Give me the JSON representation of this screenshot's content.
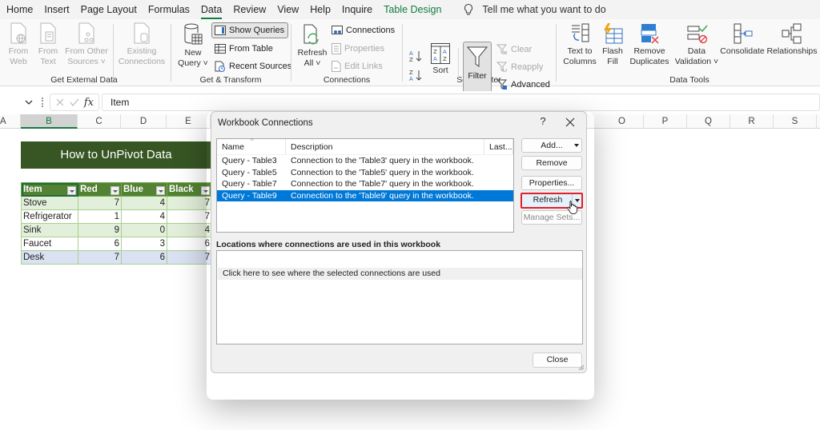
{
  "ribbon_tabs": [
    {
      "label": "Home",
      "active": false
    },
    {
      "label": "Insert",
      "active": false
    },
    {
      "label": "Page Layout",
      "active": false
    },
    {
      "label": "Formulas",
      "active": false
    },
    {
      "label": "Data",
      "active": true
    },
    {
      "label": "Review",
      "active": false
    },
    {
      "label": "View",
      "active": false
    },
    {
      "label": "Help",
      "active": false
    },
    {
      "label": "Inquire",
      "active": false
    },
    {
      "label": "Table Design",
      "active": false,
      "contextual": true
    }
  ],
  "tell_me": "Tell me what you want to do",
  "ribbon": {
    "get_external_data": {
      "label": "Get External Data",
      "from_web": [
        "From",
        "Web"
      ],
      "from_text": [
        "From",
        "Text"
      ],
      "from_other": [
        "From Other",
        "Sources ˅"
      ],
      "existing": [
        "Existing",
        "Connections"
      ]
    },
    "get_transform": {
      "label": "Get & Transform",
      "new_query": [
        "New",
        "Query ˅"
      ],
      "show_queries": "Show Queries",
      "from_table": "From Table",
      "recent_sources": "Recent Sources"
    },
    "connections": {
      "label": "Connections",
      "refresh_all": [
        "Refresh",
        "All ˅"
      ],
      "connections": "Connections",
      "properties": "Properties",
      "edit_links": "Edit Links"
    },
    "sort_filter": {
      "label": "Sort & Filter",
      "sort": "Sort",
      "filter": "Filter",
      "clear": "Clear",
      "reapply": "Reapply",
      "advanced": "Advanced"
    },
    "data_tools": {
      "label": "Data Tools",
      "text_to_columns": [
        "Text to",
        "Columns"
      ],
      "flash_fill": [
        "Flash",
        "Fill"
      ],
      "remove_duplicates": [
        "Remove",
        "Duplicates"
      ],
      "data_validation": [
        "Data",
        "Validation ˅"
      ],
      "consolidate": "Consolidate",
      "relationships": "Relationships"
    }
  },
  "formula_bar": {
    "fx": "fx",
    "value": "Item"
  },
  "columns": [
    "A",
    "B",
    "C",
    "D",
    "E",
    "O",
    "P",
    "Q",
    "R",
    "S"
  ],
  "sheet": {
    "banner": "How to UnPivot Data",
    "table": {
      "headers": [
        "Item",
        "Red",
        "Blue",
        "Black"
      ],
      "rows": [
        [
          "Stove",
          "7",
          "4",
          "7"
        ],
        [
          "Refrigerator",
          "1",
          "4",
          "7"
        ],
        [
          "Sink",
          "9",
          "0",
          "4"
        ],
        [
          "Faucet",
          "6",
          "3",
          "6"
        ],
        [
          "Desk",
          "7",
          "6",
          "7"
        ]
      ]
    }
  },
  "dialog": {
    "title": "Workbook Connections",
    "help": "?",
    "list_headers": [
      "Name",
      "Description",
      "Last..."
    ],
    "connections": [
      {
        "name": "Query - Table3",
        "description": "Connection to the 'Table3' query in the workbook.",
        "selected": false
      },
      {
        "name": "Query - Table5",
        "description": "Connection to the 'Table5' query in the workbook.",
        "selected": false
      },
      {
        "name": "Query - Table7",
        "description": "Connection to the 'Table7' query in the workbook.",
        "selected": false
      },
      {
        "name": "Query - Table9",
        "description": "Connection to the 'Table9' query in the workbook.",
        "selected": true
      }
    ],
    "buttons": {
      "add": "Add...",
      "remove": "Remove",
      "properties": "Properties...",
      "refresh": "Refresh",
      "manage_sets": "Manage Sets...",
      "close": "Close"
    },
    "locations_label": "Locations where connections are used in this workbook",
    "locations_hint": "Click here to see where the selected connections are used"
  },
  "colors": {
    "excel_green": "#107c41",
    "banner_green": "#375623",
    "table_header": "#548235",
    "selection_blue": "#0078d7",
    "highlight_red": "#e0202a"
  }
}
